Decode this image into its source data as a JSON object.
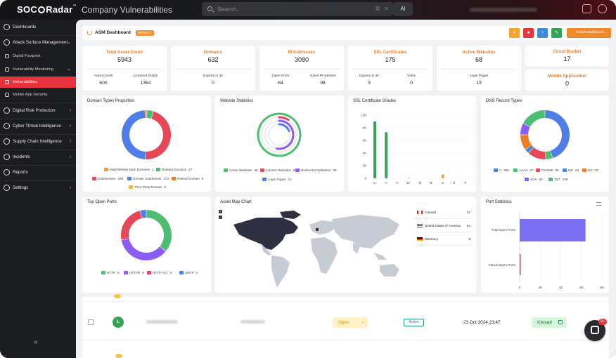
{
  "app": {
    "logo": "SOCRadar",
    "page_title": "Company Vulnerabilities"
  },
  "search": {
    "placeholder": "Search...",
    "shortcut": "⌘",
    "clear": "✕",
    "ai_label": "AI"
  },
  "sidebar": {
    "items": [
      {
        "label": "Dashboards",
        "icon": "dashboard-icon"
      },
      {
        "label": "Attack Surface Management",
        "icon": "radar-icon"
      },
      {
        "label": "Digital Footprint",
        "icon": "footprint-icon"
      },
      {
        "label": "Vulnerability Monitoring",
        "icon": "monitor-icon"
      },
      {
        "label": "Vulnerabilities",
        "icon": "bug-icon"
      },
      {
        "label": "Mobile App Security",
        "icon": "mobile-icon"
      },
      {
        "label": "Digital Risk Protection",
        "icon": "shield-icon"
      },
      {
        "label": "Cyber Threat Intelligence",
        "icon": "globe-icon"
      },
      {
        "label": "Supply Chain Intelligence",
        "icon": "chain-icon"
      },
      {
        "label": "Incidents",
        "icon": "alert-icon"
      },
      {
        "label": "Reports",
        "icon": "report-icon"
      },
      {
        "label": "Settings",
        "icon": "gear-icon"
      }
    ],
    "collapse": "«"
  },
  "asm": {
    "title": "ASM Dashboard",
    "badge": "DEFAULT",
    "switch_label": "Switch Dashboard"
  },
  "stats": {
    "total_asset": {
      "title": "Total Asset Count",
      "value": "5943",
      "sub1": "Asset Credit",
      "sub1v": "500",
      "sub2": "Licensed Assets",
      "sub2v": "1364"
    },
    "domains": {
      "title": "Domains",
      "value": "632",
      "sub1": "Expires in 30",
      "sub1v": "0"
    },
    "ip": {
      "title": "IP Addresses",
      "value": "3080",
      "sub1": "Open Ports",
      "sub1v": "64",
      "sub2": "Active IP Address",
      "sub2v": "96"
    },
    "ssl": {
      "title": "SSL Certificates",
      "value": "175",
      "sub1": "Expires in 30",
      "sub1v": "3",
      "sub2": "Vulns",
      "sub2v": "0"
    },
    "websites": {
      "title": "Active Websites",
      "value": "68",
      "sub1": "Login Pages",
      "sub1v": "13"
    },
    "cloud": {
      "title": "Cloud Bucket",
      "value": "17"
    },
    "mobile": {
      "title": "Mobile Application",
      "value": "0"
    }
  },
  "cards": {
    "domain_types": {
      "title": "Domain Types Proportion",
      "legend": [
        {
          "label": "Mail/Website Main Domains",
          "value": "1",
          "color": "#f29a38"
        },
        {
          "label": "Related Domains",
          "value": "27",
          "color": "#4dbd74"
        },
        {
          "label": "Subdomains",
          "value": "296",
          "color": "#e64857"
        },
        {
          "label": "Domain Subdomain",
          "value": "313",
          "color": "#4f7ee8"
        },
        {
          "label": "Parked Domain",
          "value": "8",
          "color": "#ee7c22"
        },
        {
          "label": "Third Party Domain",
          "value": "0",
          "color": "#f5b94a"
        }
      ]
    },
    "website_stats": {
      "title": "Website Statistics",
      "legend": [
        {
          "label": "Active Websites",
          "value": "68",
          "color": "#4dbd74"
        },
        {
          "label": "Inactive Websites",
          "value": "6",
          "color": "#e64857"
        },
        {
          "label": "Redirected Websites",
          "value": "36",
          "color": "#8b5cf6"
        },
        {
          "label": "Login Pages",
          "value": "13",
          "color": "#4f7ee8"
        }
      ]
    },
    "ssl_grades": {
      "title": "SSL Certificate Grades"
    },
    "dns": {
      "title": "DNS Record Types",
      "legend": [
        {
          "label": "A",
          "value": "359",
          "color": "#4f7ee8"
        },
        {
          "label": "AAAA",
          "value": "37",
          "color": "#4dbd74"
        },
        {
          "label": "CNAME",
          "value": "98",
          "color": "#e64857"
        },
        {
          "label": "MX",
          "value": "23",
          "color": "#3f8bd8"
        },
        {
          "label": "NS",
          "value": "83",
          "color": "#ee7c22"
        },
        {
          "label": "SOA",
          "value": "62",
          "color": "#8b5cf6"
        },
        {
          "label": "TXT",
          "value": "138",
          "color": "#4dbd74"
        }
      ]
    },
    "top_ports": {
      "title": "Top Open Ports",
      "legend": [
        {
          "label": "HTTP",
          "value": "9",
          "color": "#4dbd74"
        },
        {
          "label": "HTTPS",
          "value": "9",
          "color": "#8b5cf6"
        },
        {
          "label": "HTTP-ALT",
          "value": "6",
          "color": "#e64857"
        },
        {
          "label": "SMTP",
          "value": "1",
          "color": "#4f7ee8"
        }
      ]
    },
    "asset_map": {
      "title": "Asset Map Chart",
      "countries": [
        {
          "name": "Canada",
          "value": "22",
          "flag": "canada-flag"
        },
        {
          "name": "United States of America",
          "value": "54",
          "flag": "usa-flag"
        },
        {
          "name": "Germany",
          "value": "3",
          "flag": "germany-flag"
        }
      ]
    },
    "port_stats": {
      "title": "Port Statistics"
    }
  },
  "chart_data": [
    {
      "type": "pie",
      "title": "Domain Types Proportion",
      "labels": [
        "Mail/Website Main Domains",
        "Related Domains",
        "Subdomains",
        "Domain Subdomain",
        "Parked Domain",
        "Third Party Domain"
      ],
      "values": [
        1,
        27,
        296,
        313,
        8,
        0
      ]
    },
    {
      "type": "pie",
      "title": "Website Statistics",
      "labels": [
        "Active Websites",
        "Inactive Websites",
        "Redirected Websites",
        "Login Pages"
      ],
      "values": [
        68,
        6,
        36,
        13
      ]
    },
    {
      "type": "bar",
      "title": "SSL Certificate Grades",
      "categories": [
        "A+",
        "A",
        "A-",
        "B+",
        "B",
        "B-",
        "C",
        "D",
        "F"
      ],
      "values": [
        90,
        73,
        0,
        1,
        0,
        0,
        6,
        0,
        0
      ],
      "ylim": [
        0,
        100
      ],
      "yticks": [
        "100",
        "80",
        "60",
        "40",
        "20",
        "0"
      ]
    },
    {
      "type": "pie",
      "title": "DNS Record Types",
      "labels": [
        "A",
        "AAAA",
        "CNAME",
        "MX",
        "NS",
        "SOA",
        "TXT"
      ],
      "values": [
        359,
        37,
        98,
        23,
        83,
        62,
        138
      ]
    },
    {
      "type": "pie",
      "title": "Top Open Ports",
      "labels": [
        "HTTP",
        "HTTPS",
        "HTTP-ALT",
        "SMTP"
      ],
      "values": [
        9,
        9,
        6,
        1
      ]
    },
    {
      "type": "bar",
      "title": "Port Statistics",
      "categories": [
        "Total Open Ports",
        "Critical Open Ports"
      ],
      "values": [
        64,
        1
      ],
      "xlim": [
        0,
        80
      ],
      "xticks": [
        "0",
        "20",
        "40",
        "60",
        "80"
      ]
    }
  ],
  "table": {
    "row": {
      "avatar": "L",
      "status": "Open",
      "state": "Active",
      "date": "23 Oct 2024 23:47",
      "resolution": "Closed"
    }
  },
  "chat": {
    "badge": "9+"
  }
}
